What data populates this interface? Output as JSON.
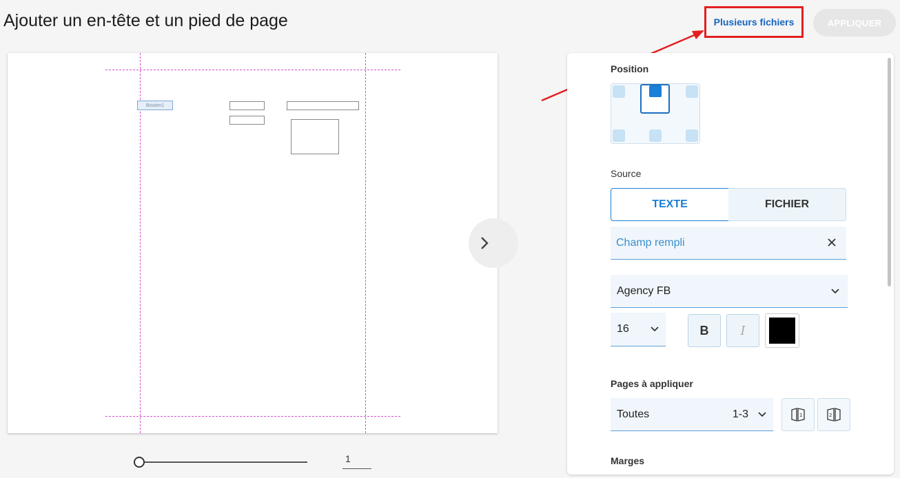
{
  "header": {
    "title": "Ajouter un en-tête et un pied de page",
    "multi_files_label": "Plusieurs fichiers",
    "apply_label": "APPLIQUER"
  },
  "colors": {
    "accent": "#1a7fd6",
    "highlight": "#e31f1f",
    "guide": "#d44ad4",
    "text_color_swatch": "#000000"
  },
  "preview": {
    "form_button_label": "Bouton1",
    "next_icon": "chevron-right-icon",
    "zoom_fraction": 0.0,
    "page_number": "1"
  },
  "panel": {
    "position_label": "Position",
    "source_label": "Source",
    "source_text_tab": "TEXTE",
    "source_file_tab": "FICHIER",
    "text_value": "Champ rempli",
    "clear_icon": "close-icon",
    "font_family": "Agency FB",
    "font_size": "16",
    "bold_label": "B",
    "italic_label": "I",
    "pages_label": "Pages à appliquer",
    "pages_value": "Toutes",
    "pages_range": "1-3",
    "margins_label": "Marges"
  }
}
